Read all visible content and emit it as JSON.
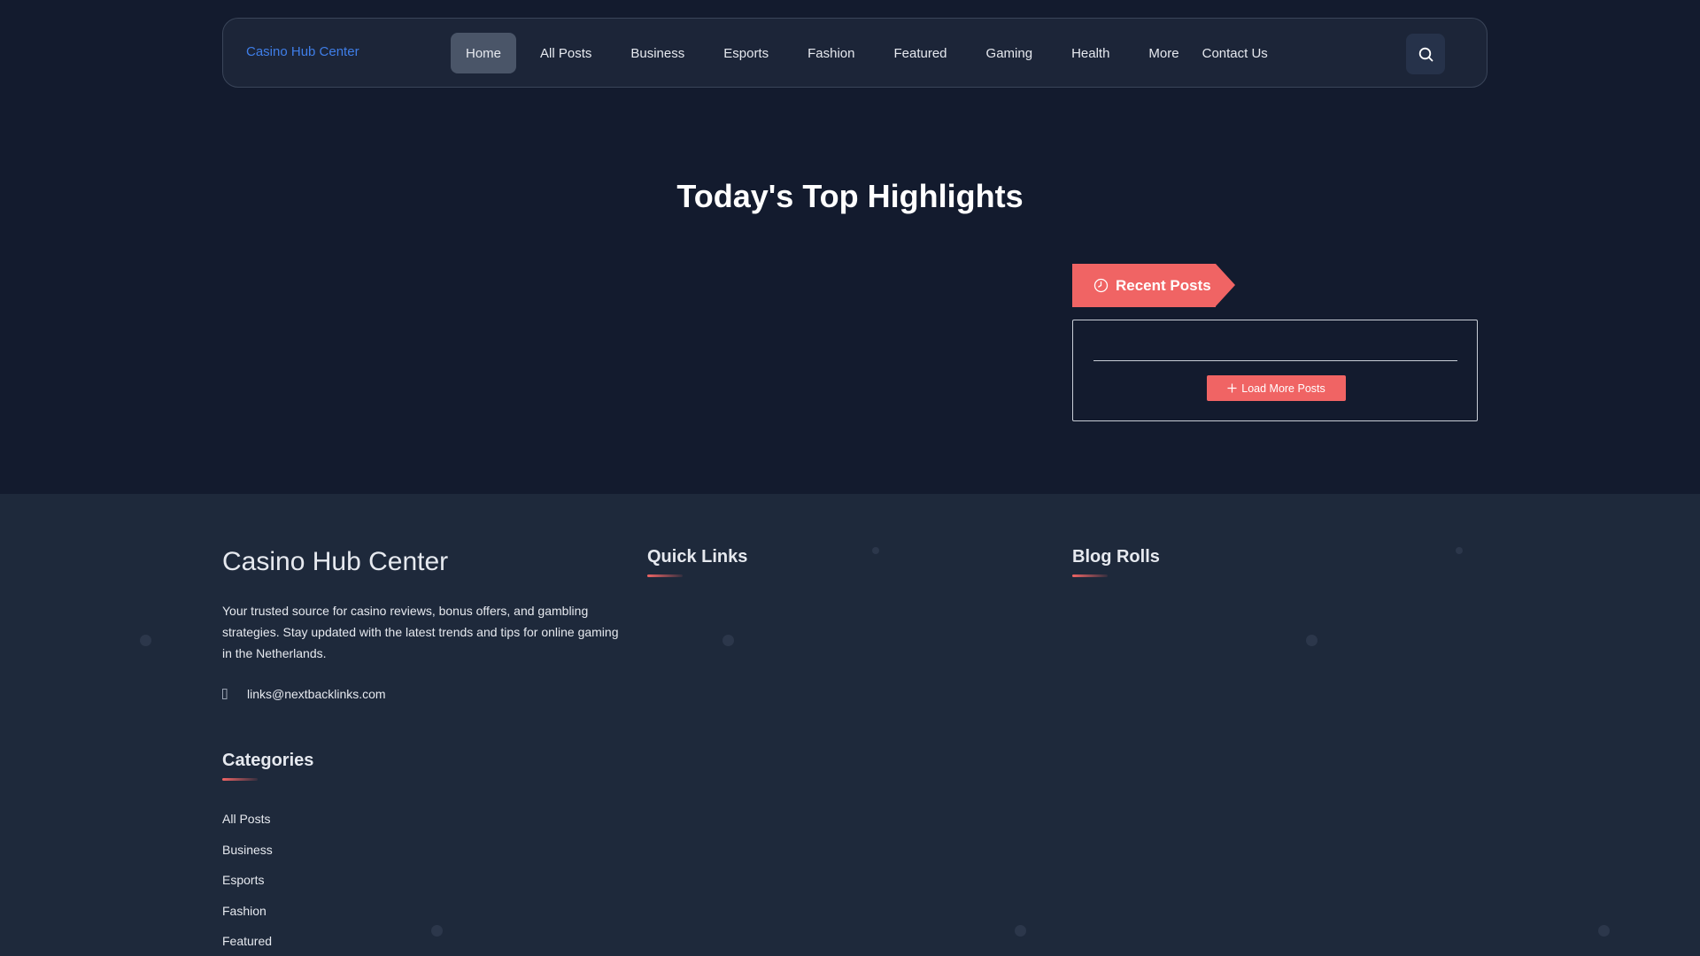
{
  "header": {
    "logo": "Casino Hub Center",
    "nav": [
      {
        "label": "Home",
        "active": true
      },
      {
        "label": "All Posts"
      },
      {
        "label": "Business"
      },
      {
        "label": "Esports"
      },
      {
        "label": "Fashion"
      },
      {
        "label": "Featured"
      },
      {
        "label": "Gaming"
      },
      {
        "label": "Health"
      },
      {
        "label": "More"
      },
      {
        "label": "Contact Us"
      }
    ],
    "search_icon": "search-icon"
  },
  "hero": {
    "title": "Today's Top Highlights"
  },
  "recent_posts": {
    "tab_label": "Recent Posts",
    "tab_icon": "clock-icon",
    "load_more_label": "Load More Posts",
    "load_more_icon": "plus-icon"
  },
  "footer": {
    "brand": "Casino Hub Center",
    "description": "Your trusted source for casino reviews, bonus offers, and gambling strategies. Stay updated with the latest trends and tips for online gaming in the Netherlands.",
    "email_icon": "envelope-icon",
    "email": "links@nextbacklinks.com",
    "quick_links_heading": "Quick Links",
    "blog_rolls_heading": "Blog Rolls",
    "categories_heading": "Categories",
    "categories": [
      "All Posts",
      "Business",
      "Esports",
      "Fashion",
      "Featured"
    ]
  },
  "colors": {
    "background": "#131b2e",
    "header_bg": "#1c2538",
    "footer_bg": "#1e293b",
    "accent": "#f06464",
    "logo": "#3f7ee8",
    "active_nav": "#4a5568"
  }
}
